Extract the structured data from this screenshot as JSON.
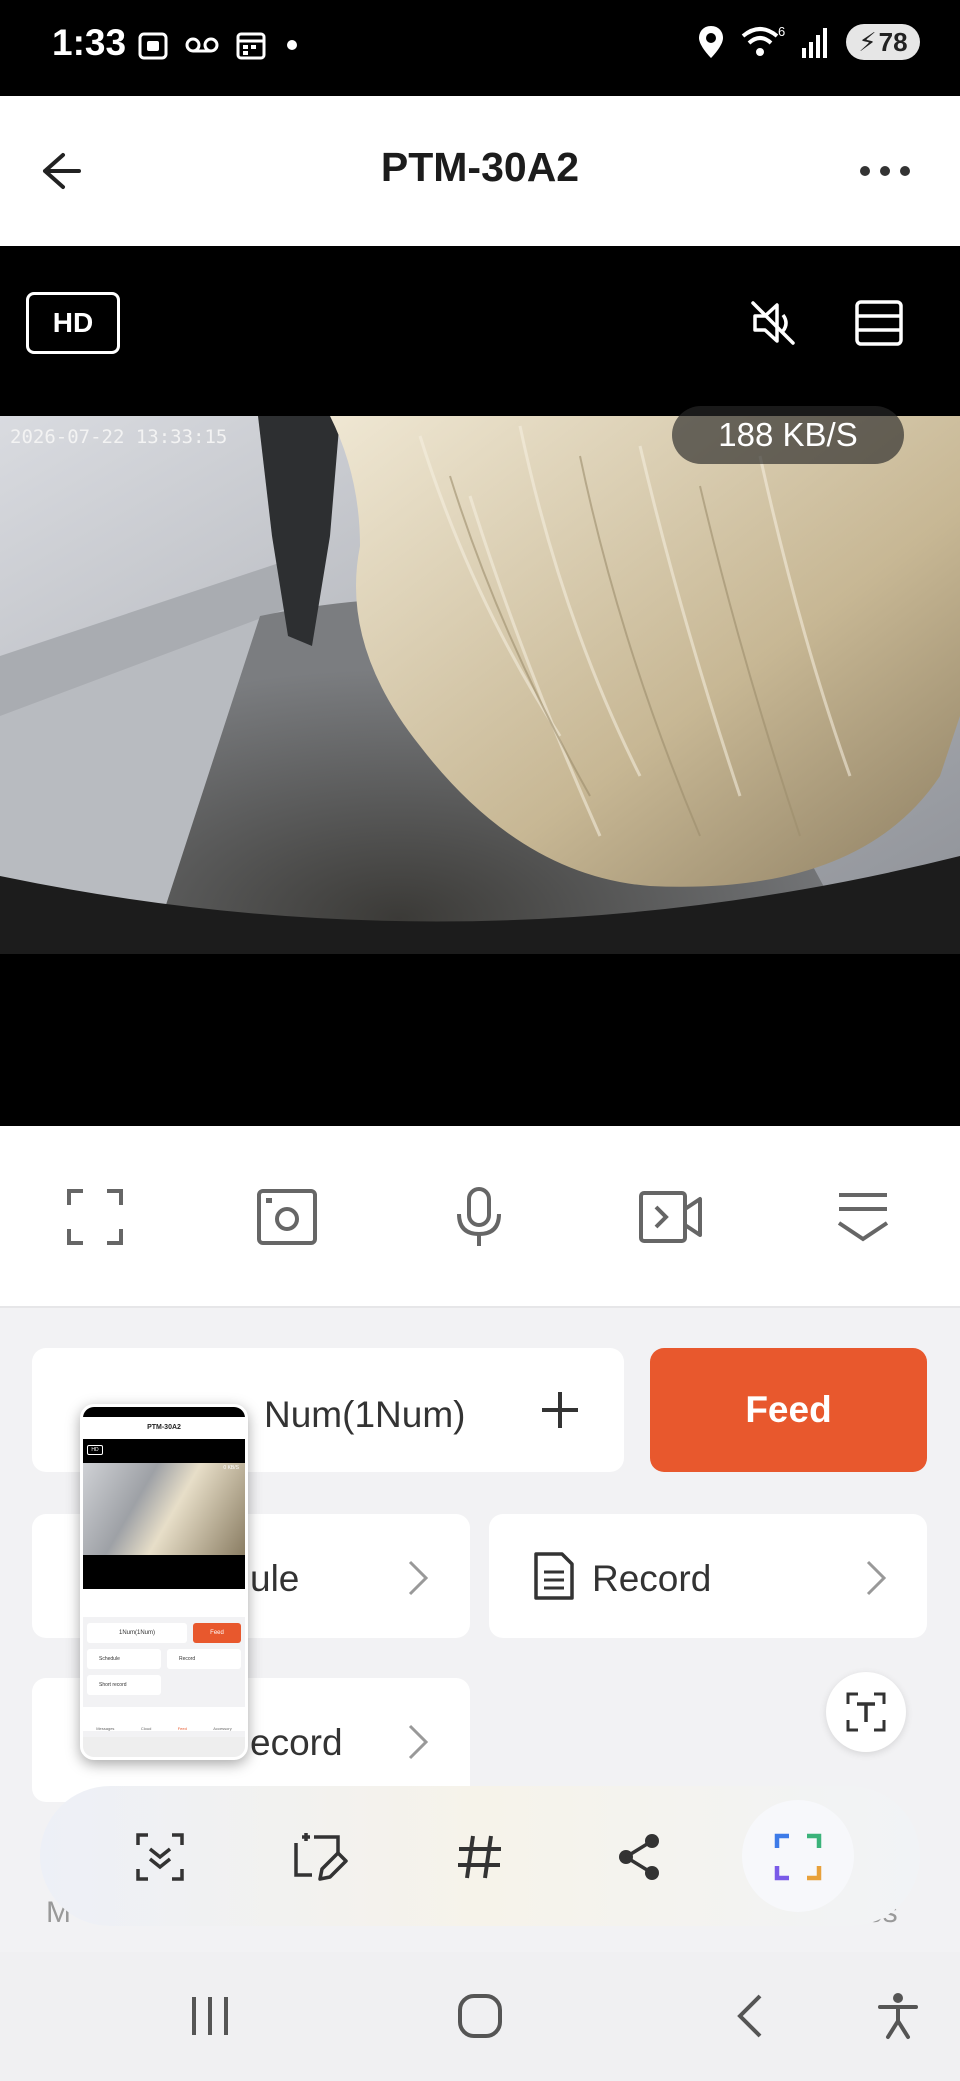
{
  "status_bar": {
    "time": "1:33",
    "battery": "78",
    "wifi_badge": "6"
  },
  "header": {
    "title": "PTM-30A2"
  },
  "video": {
    "quality_badge": "HD",
    "timestamp": "2026-07-22 13:33:15",
    "data_rate": "188 KB/S"
  },
  "controls": {
    "items": [
      "fullscreen-icon",
      "snapshot-icon",
      "microphone-icon",
      "record-video-icon",
      "collapse-icon"
    ]
  },
  "feed": {
    "quantity_label": "Num(1Num)",
    "plus": "+",
    "feed_button": "Feed"
  },
  "cards": {
    "schedule_label_fragment": "ule",
    "record_label": "Record",
    "short_record_fragment": "ecord"
  },
  "background_fragments": {
    "left": "M",
    "right": "es"
  },
  "thumbnail": {
    "title": "PTM-30A2",
    "hd": "HD",
    "rate": "0 KB/S",
    "qty": "1Num(1Num)",
    "feed": "Feed",
    "schedule": "Schedule",
    "record": "Record",
    "short_record": "Short record",
    "tabs": [
      "Messages",
      "Cloud",
      "Feed",
      "Accessory"
    ]
  },
  "colors": {
    "accent": "#e8582d",
    "background": "#f2f2f4",
    "card": "#ffffff"
  }
}
